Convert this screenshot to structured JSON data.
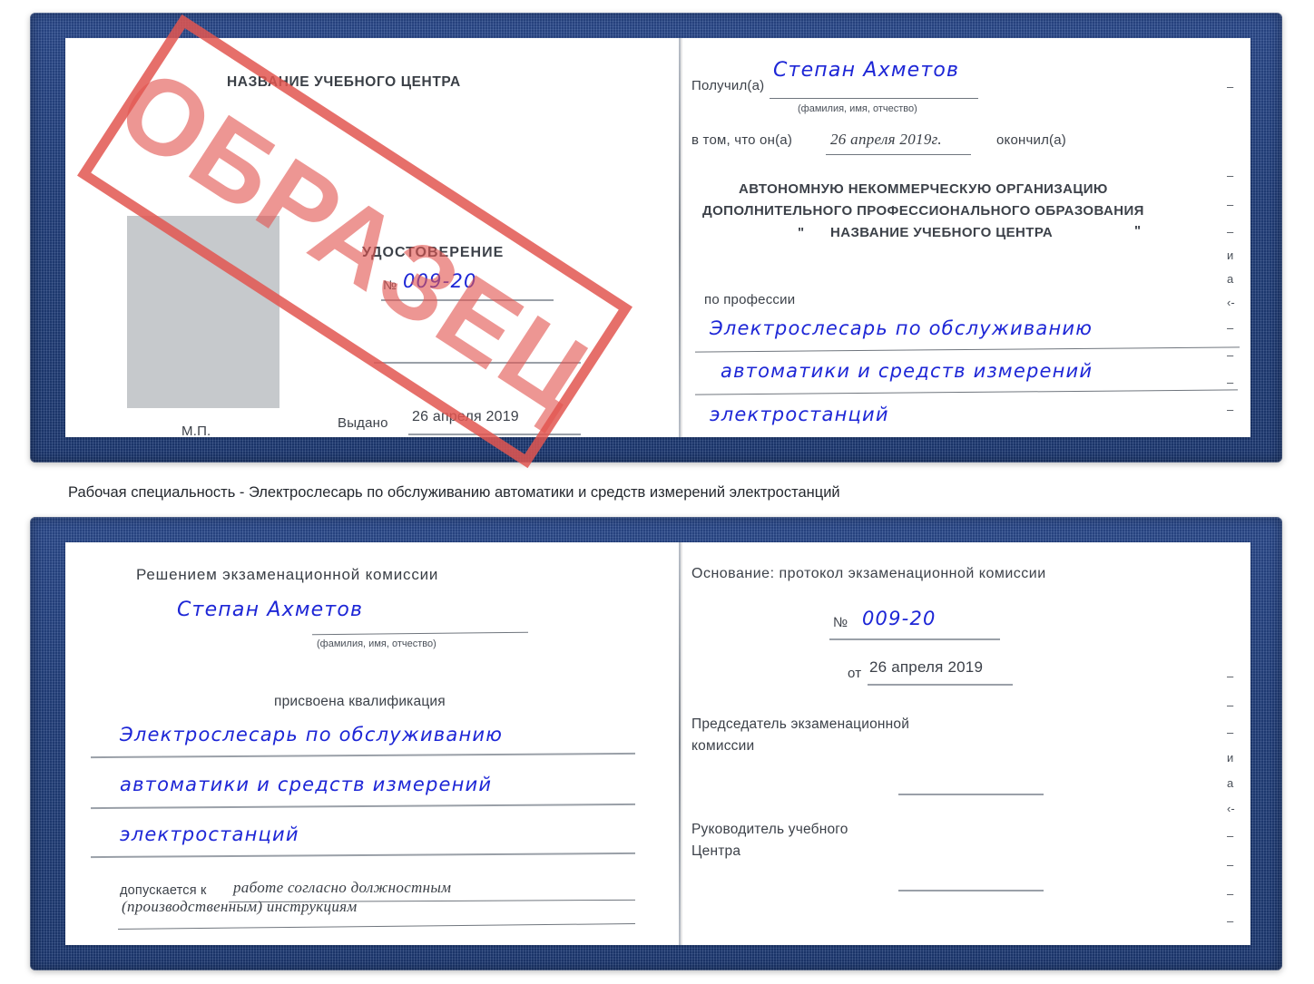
{
  "document": {
    "type": "Удостоверение (рабочая специальность)",
    "sample_stamp": "ОБРАЗЕЦ",
    "accent_blue": "#1d3a74",
    "ink_blue": "#1d26d6",
    "stamp_red": "#e25650"
  },
  "certificate_top": {
    "left_page": {
      "center_name": "НАЗВАНИЕ УЧЕБНОГО ЦЕНТРА",
      "title": "УДОСТОВЕРЕНИЕ",
      "number_label": "№",
      "number_value": "009-20",
      "issued_label": "Выдано",
      "issued_value": "26 апреля 2019",
      "seal_label": "М.П."
    },
    "right_page": {
      "received_label": "Получил(а)",
      "received_value": "Степан Ахметов",
      "fio_hint": "(фамилия, имя, отчество)",
      "in_that_label": "в том, что он(а)",
      "finished_date": "26 апреля 2019г.",
      "finished_label": "окончил(а)",
      "org_line1": "АВТОНОМНУЮ НЕКОММЕРЧЕСКУЮ ОРГАНИЗАЦИЮ",
      "org_line2": "ДОПОЛНИТЕЛЬНОГО ПРОФЕССИОНАЛЬНОГО ОБРАЗОВАНИЯ",
      "org_quote_open": "\"",
      "org_line3": "НАЗВАНИЕ УЧЕБНОГО ЦЕНТРА",
      "org_quote_close": "\"",
      "profession_label": "по профессии",
      "profession_line1": "Электрослесарь по обслуживанию",
      "profession_line2": "автоматики и средств измерений",
      "profession_line3": "электростанций",
      "edge_marks": [
        "–",
        "–",
        "–",
        "–",
        "и",
        "а",
        "‹-",
        "–",
        "–",
        "–",
        "–"
      ]
    }
  },
  "caption": "Рабочая специальность - Электрослесарь по обслуживанию автоматики и средств измерений электростанций",
  "certificate_bottom": {
    "left_page": {
      "heading": "Решением экзаменационной комиссии",
      "name_value": "Степан Ахметов",
      "fio_hint": "(фамилия, имя, отчество)",
      "qualification_label": "присвоена квалификация",
      "qualification_line1": "Электрослесарь по обслуживанию",
      "qualification_line2": "автоматики и средств измерений",
      "qualification_line3": "электростанций",
      "admitted_label": "допускается к",
      "admitted_line1": "работе согласно должностным",
      "admitted_line2": "(производственным) инструкциям"
    },
    "right_page": {
      "basis_label": "Основание: протокол экзаменационной комиссии",
      "number_label": "№",
      "number_value": "009-20",
      "date_label": "от",
      "date_value": "26 апреля 2019",
      "chairman_line1": "Председатель экзаменационной",
      "chairman_line2": "комиссии",
      "head_line1": "Руководитель учебного",
      "head_line2": "Центра",
      "edge_marks": [
        "–",
        "–",
        "–",
        "и",
        "а",
        "‹-",
        "–",
        "–",
        "–",
        "–"
      ]
    }
  }
}
